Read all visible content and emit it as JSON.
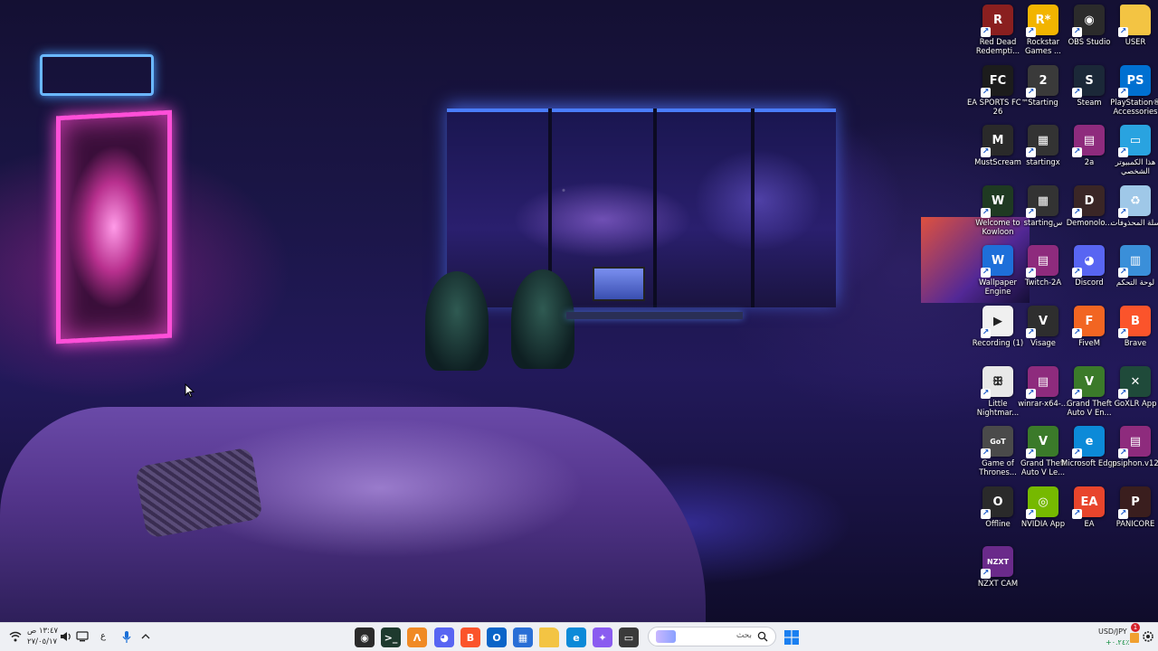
{
  "desktop": {
    "icons": [
      {
        "label": "Red Dead Redempti...",
        "icon": "red-dead-icon",
        "color": "#8a1f1f",
        "glyph": "R"
      },
      {
        "label": "Rockstar Games ...",
        "icon": "rockstar-icon",
        "color": "#f2b400",
        "glyph": "R*"
      },
      {
        "label": "OBS Studio",
        "icon": "obs-icon",
        "color": "#2b2b2b",
        "glyph": "◉"
      },
      {
        "label": "USER",
        "icon": "folder-icon",
        "color": "#f3c443",
        "glyph": ""
      },
      {
        "label": "EA SPORTS FC™ 26",
        "icon": "ea-fc-icon",
        "color": "#1c1c1c",
        "glyph": "FC"
      },
      {
        "label": "Starting",
        "icon": "starting-icon",
        "color": "#3a3a3a",
        "glyph": "2"
      },
      {
        "label": "Steam",
        "icon": "steam-icon",
        "color": "#1b2838",
        "glyph": "S"
      },
      {
        "label": "PlayStation® Accessories",
        "icon": "playstation-icon",
        "color": "#0070d1",
        "glyph": "PS"
      },
      {
        "label": "MustScream",
        "icon": "mustscream-icon",
        "color": "#2a2a2a",
        "glyph": "M"
      },
      {
        "label": "startingx",
        "icon": "video-file-icon",
        "color": "#333333",
        "glyph": "▦"
      },
      {
        "label": "2a",
        "icon": "winrar-icon",
        "color": "#8e2b7d",
        "glyph": "▤"
      },
      {
        "label": "هذا الكمبيوتر الشخصي",
        "icon": "this-pc-icon",
        "color": "#29a3e0",
        "glyph": "▭"
      },
      {
        "label": "Welcome to Kowloon",
        "icon": "kowloon-icon",
        "color": "#1f3a22",
        "glyph": "W"
      },
      {
        "label": "startingس",
        "icon": "video-file-icon",
        "color": "#333333",
        "glyph": "▦"
      },
      {
        "label": "Demonolo...",
        "icon": "demonologist-icon",
        "color": "#3a2626",
        "glyph": "D"
      },
      {
        "label": "سلة المحذوفات",
        "icon": "recycle-bin-icon",
        "color": "#9fc8e8",
        "glyph": "♻"
      },
      {
        "label": "Wallpaper Engine",
        "icon": "wallpaper-engine-icon",
        "color": "#1e6fd9",
        "glyph": "W"
      },
      {
        "label": "Twitch-2A",
        "icon": "winrar-icon",
        "color": "#8e2b7d",
        "glyph": "▤"
      },
      {
        "label": "Discord",
        "icon": "discord-icon",
        "color": "#5865f2",
        "glyph": "◕"
      },
      {
        "label": "لوحة التحكم",
        "icon": "control-panel-icon",
        "color": "#3a8fd9",
        "glyph": "▥"
      },
      {
        "label": "Recording (1)",
        "icon": "media-file-icon",
        "color": "#f0f0f0",
        "glyph": "▶"
      },
      {
        "label": "Visage",
        "icon": "visage-icon",
        "color": "#2e2e2e",
        "glyph": "V"
      },
      {
        "label": "FiveM",
        "icon": "fivem-icon",
        "color": "#f26522",
        "glyph": "F"
      },
      {
        "label": "Brave",
        "icon": "brave-icon",
        "color": "#fb542b",
        "glyph": "B"
      },
      {
        "label": "Little Nightmar...",
        "icon": "little-nightmares-icon",
        "color": "#e8e8e8",
        "glyph": "ꕥ"
      },
      {
        "label": "winrar-x64-...",
        "icon": "winrar-icon",
        "color": "#8e2b7d",
        "glyph": "▤"
      },
      {
        "label": "Grand Theft Auto V En...",
        "icon": "gta-v-icon",
        "color": "#3b7a2a",
        "glyph": "V"
      },
      {
        "label": "GoXLR App",
        "icon": "goxlr-icon",
        "color": "#1f4a3a",
        "glyph": "✕"
      },
      {
        "label": "Game of Thrones...",
        "icon": "game-of-thrones-icon",
        "color": "#4a4a4a",
        "glyph": "GoT"
      },
      {
        "label": "Grand Theft Auto V Le...",
        "icon": "gta-v-icon",
        "color": "#3b7a2a",
        "glyph": "V"
      },
      {
        "label": "Microsoft Edge",
        "icon": "edge-icon",
        "color": "#0c8ad8",
        "glyph": "e"
      },
      {
        "label": "psiphon.v12",
        "icon": "winrar-icon",
        "color": "#8e2b7d",
        "glyph": "▤"
      },
      {
        "label": "Offline",
        "icon": "offline-icon",
        "color": "#2a2a2a",
        "glyph": "O"
      },
      {
        "label": "NVIDIA App",
        "icon": "nvidia-icon",
        "color": "#76b900",
        "glyph": "◎"
      },
      {
        "label": "EA",
        "icon": "ea-icon",
        "color": "#e8452c",
        "glyph": "EA"
      },
      {
        "label": "PANICORE",
        "icon": "panicore-icon",
        "color": "#3a1e1e",
        "glyph": "P"
      },
      {
        "label": "NZXT CAM",
        "icon": "nzxt-icon",
        "color": "#6a2a8a",
        "glyph": "NZXT"
      }
    ]
  },
  "taskbar": {
    "search_placeholder": "بحث",
    "clock_time": "١٣:٤٧ ص",
    "clock_date": "٢٧/٠٥/١٧",
    "lang": "ع",
    "stock_symbol": "USD/JPY",
    "stock_change": "+٠.٢٤٪",
    "notification_count": "1",
    "pinned": [
      {
        "icon": "obs-icon",
        "color": "#2b2b2b",
        "glyph": "◉"
      },
      {
        "icon": "terminal-icon",
        "color": "#1e3a2e",
        "glyph": ">_"
      },
      {
        "icon": "fl-studio-icon",
        "color": "#f08a24",
        "glyph": "Λ"
      },
      {
        "icon": "discord-icon",
        "color": "#5865f2",
        "glyph": "◕"
      },
      {
        "icon": "brave-icon",
        "color": "#fb542b",
        "glyph": "B"
      },
      {
        "icon": "outlook-icon",
        "color": "#0a64c8",
        "glyph": "O"
      },
      {
        "icon": "store-icon",
        "color": "#2a6fd6",
        "glyph": "▦"
      },
      {
        "icon": "file-explorer-icon",
        "color": "#f3c443",
        "glyph": ""
      },
      {
        "icon": "edge-icon",
        "color": "#0c8ad8",
        "glyph": "e"
      },
      {
        "icon": "copilot-icon",
        "color": "#8a5cf0",
        "glyph": "✦"
      },
      {
        "icon": "task-view-icon",
        "color": "#3a3a3a",
        "glyph": "▭"
      }
    ]
  }
}
